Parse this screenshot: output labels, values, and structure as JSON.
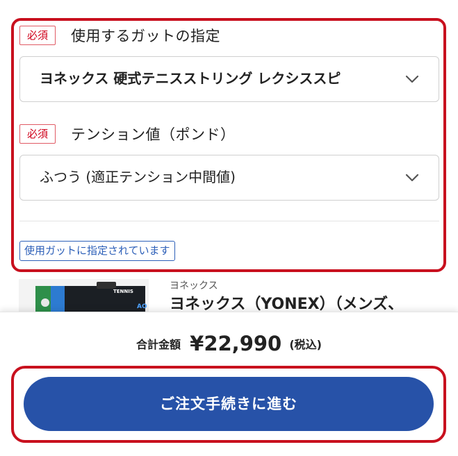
{
  "options": {
    "gut": {
      "required_badge": "必須",
      "label": "使用するガットの指定",
      "selected": "ヨネックス 硬式テニスストリング レクシススピ",
      "icon": "chevron-down-icon"
    },
    "tension": {
      "required_badge": "必須",
      "label": "テンション値（ポンド）",
      "selected": "ふつう (適正テンション中間値)",
      "icon": "chevron-down-icon"
    },
    "notice": "使用ガットに指定されています"
  },
  "product": {
    "brand": "ヨネックス",
    "name": "ヨネックス（YONEX）（メンズ、",
    "thumb_text": "TENNIS"
  },
  "summary": {
    "total_label": "合計金額",
    "total_price": "¥22,990",
    "tax_note": "(税込)"
  },
  "checkout_button": "ご注文手続きに進む",
  "colors": {
    "highlight": "#c8101e",
    "required": "#d0021b",
    "accent_blue": "#2752a8",
    "notice_blue": "#2c5fb8"
  }
}
